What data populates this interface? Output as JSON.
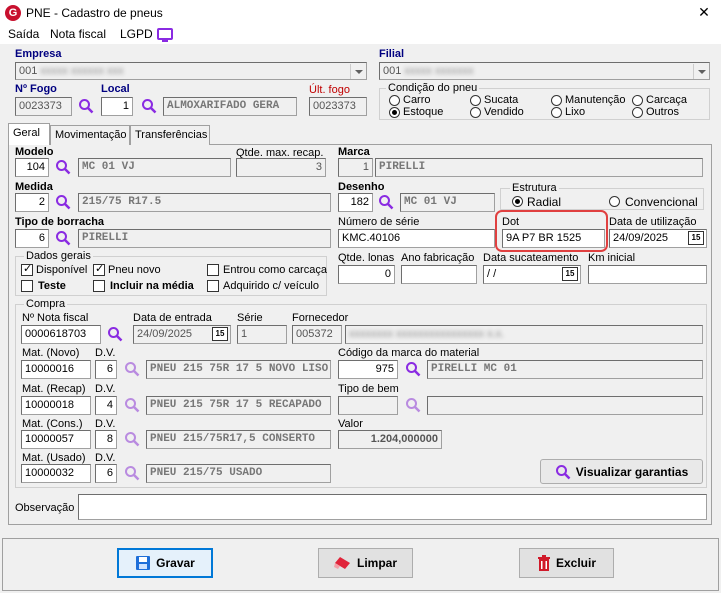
{
  "window": {
    "title": "PNE - Cadastro de pneus",
    "close": "✕"
  },
  "menu": {
    "items": [
      "Saída",
      "Nota fiscal",
      "LGPD"
    ]
  },
  "empresa": {
    "label": "Empresa",
    "value": "001"
  },
  "filial": {
    "label": "Filial",
    "value": "001"
  },
  "fogo": {
    "label": "Nº Fogo",
    "value": "0023373"
  },
  "local": {
    "label": "Local",
    "code": "1",
    "name": "ALMOXARIFADO GERA"
  },
  "ult_fogo": {
    "label": "Últ. fogo",
    "value": "0023373"
  },
  "condicao": {
    "title": "Condição do pneu",
    "options": [
      "Carro",
      "Sucata",
      "Manutenção",
      "Carcaça",
      "Estoque",
      "Vendido",
      "Lixo",
      "Outros"
    ],
    "selected": "Estoque"
  },
  "tabs": [
    "Geral",
    "Movimentação",
    "Transferências"
  ],
  "modelo": {
    "label": "Modelo",
    "code": "104",
    "name": "MC 01 VJ"
  },
  "qtde_max_recap": {
    "label": "Qtde. max. recap.",
    "value": "3"
  },
  "marca": {
    "label": "Marca",
    "code": "1",
    "name": "PIRELLI"
  },
  "medida": {
    "label": "Medida",
    "code": "2",
    "name": "215/75 R17.5"
  },
  "desenho": {
    "label": "Desenho",
    "code": "182",
    "name": "MC 01 VJ"
  },
  "estrutura": {
    "title": "Estrutura",
    "options": [
      "Radial",
      "Convencional"
    ],
    "selected": "Radial"
  },
  "tipo_borracha": {
    "label": "Tipo de borracha",
    "code": "6",
    "name": "PIRELLI"
  },
  "numero_serie": {
    "label": "Número de série",
    "value": "KMC.40106"
  },
  "dot": {
    "label": "Dot",
    "value": "9A P7 BR 1525"
  },
  "data_utilizacao": {
    "label": "Data de utilização",
    "value": "24/09/2025"
  },
  "dados_gerais": {
    "title": "Dados gerais",
    "disponivel": "Disponível",
    "pneu_novo": "Pneu novo",
    "entrou_carcaca": "Entrou como carcaça",
    "teste": "Teste",
    "incluir_media": "Incluir na média",
    "adquirido_veiculo": "Adquirido c/ veículo"
  },
  "qtde_lonas": {
    "label": "Qtde. lonas",
    "value": "0"
  },
  "ano_fabricacao": {
    "label": "Ano fabricação",
    "value": ""
  },
  "data_sucateamento": {
    "label": "Data sucateamento",
    "value": " / /"
  },
  "km_inicial": {
    "label": "Km inicial",
    "value": ""
  },
  "compra": {
    "title": "Compra",
    "nf_label": "Nº Nota fiscal",
    "nf_value": "0000618703",
    "data_entrada_label": "Data de entrada",
    "data_entrada_value": "24/09/2025",
    "serie_label": "Série",
    "serie_value": "1",
    "fornecedor_label": "Fornecedor",
    "fornecedor_code": "005372",
    "dv_label": "D.V.",
    "mat_novo_label": "Mat. (Novo)",
    "mat_novo_code": "10000016",
    "mat_novo_dv": "6",
    "mat_novo_name": "PNEU 215 75R 17 5 NOVO LISO",
    "mat_recap_label": "Mat. (Recap)",
    "mat_recap_code": "10000018",
    "mat_recap_dv": "4",
    "mat_recap_name": "PNEU 215 75R 17 5 RECAPADO",
    "mat_cons_label": "Mat. (Cons.)",
    "mat_cons_code": "10000057",
    "mat_cons_dv": "8",
    "mat_cons_name": "PNEU 215/75R17,5 CONSERTO",
    "mat_usado_label": "Mat. (Usado)",
    "mat_usado_code": "10000032",
    "mat_usado_dv": "6",
    "mat_usado_name": "PNEU 215/75 USADO",
    "cod_marca_label": "Código da marca do material",
    "cod_marca_code": "975",
    "cod_marca_name": "PIRELLI MC 01",
    "tipo_bem_label": "Tipo de bem",
    "valor_label": "Valor",
    "valor_value": "1.204,000000",
    "garantias_btn": "Visualizar garantias"
  },
  "observacao": {
    "label": "Observação",
    "value": ""
  },
  "buttons": {
    "gravar": "Gravar",
    "limpar": "Limpar",
    "excluir": "Excluir"
  },
  "cal_glyph": "15"
}
